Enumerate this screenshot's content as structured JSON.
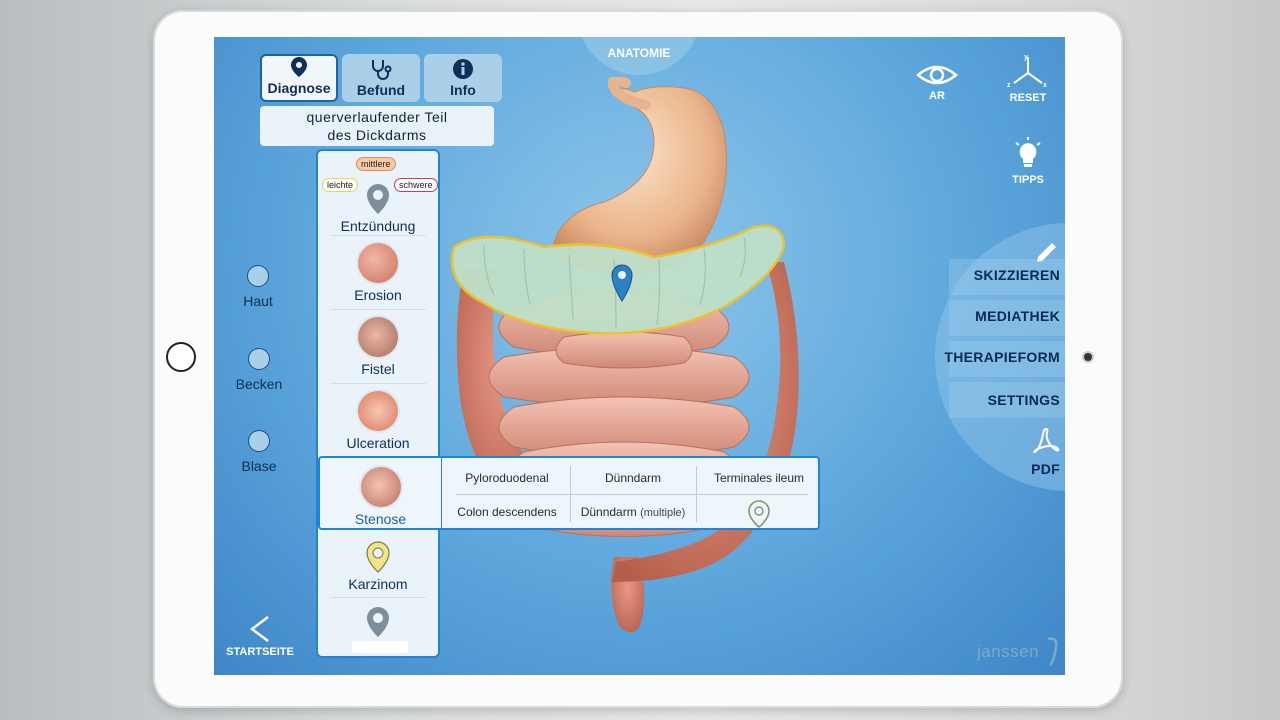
{
  "tabs": [
    {
      "label": "Diagnose",
      "icon": "location-pin-icon",
      "active": true
    },
    {
      "label": "Befund",
      "icon": "stethoscope-icon",
      "active": false
    },
    {
      "label": "Info",
      "icon": "info-icon",
      "active": false
    }
  ],
  "location_label": {
    "line1": "querverlaufender Teil",
    "line2": "des Dickdarms"
  },
  "anatomie_label": "ANATOMIE",
  "top_right": {
    "ar": "AR",
    "reset": "RESET",
    "tipps": "TIPPS"
  },
  "left_options": [
    "Haut",
    "Becken",
    "Blase"
  ],
  "severity": {
    "mild": "leichte",
    "medium": "mittlere",
    "severe": "schwere"
  },
  "diagnoses": [
    "Entzündung",
    "Erosion",
    "Fistel",
    "Ulceration",
    "Stenose",
    "Karzinom"
  ],
  "stenose_locations": {
    "row1": [
      "Pyloroduodenal",
      "Dünndarm",
      "Terminales ileum"
    ],
    "row2": [
      "Colon descendens",
      "Dünndarm",
      "(multiple)"
    ]
  },
  "right_menu": [
    "SKIZZIEREN",
    "MEDIATHEK",
    "THERAPIEFORM",
    "SETTINGS",
    "PDF"
  ],
  "startseite": "STARTSEITE",
  "brand": "janssen",
  "colors": {
    "accent": "#1f86d6",
    "navy": "#0b2a54",
    "colon_highlight": "#f0c22a"
  }
}
